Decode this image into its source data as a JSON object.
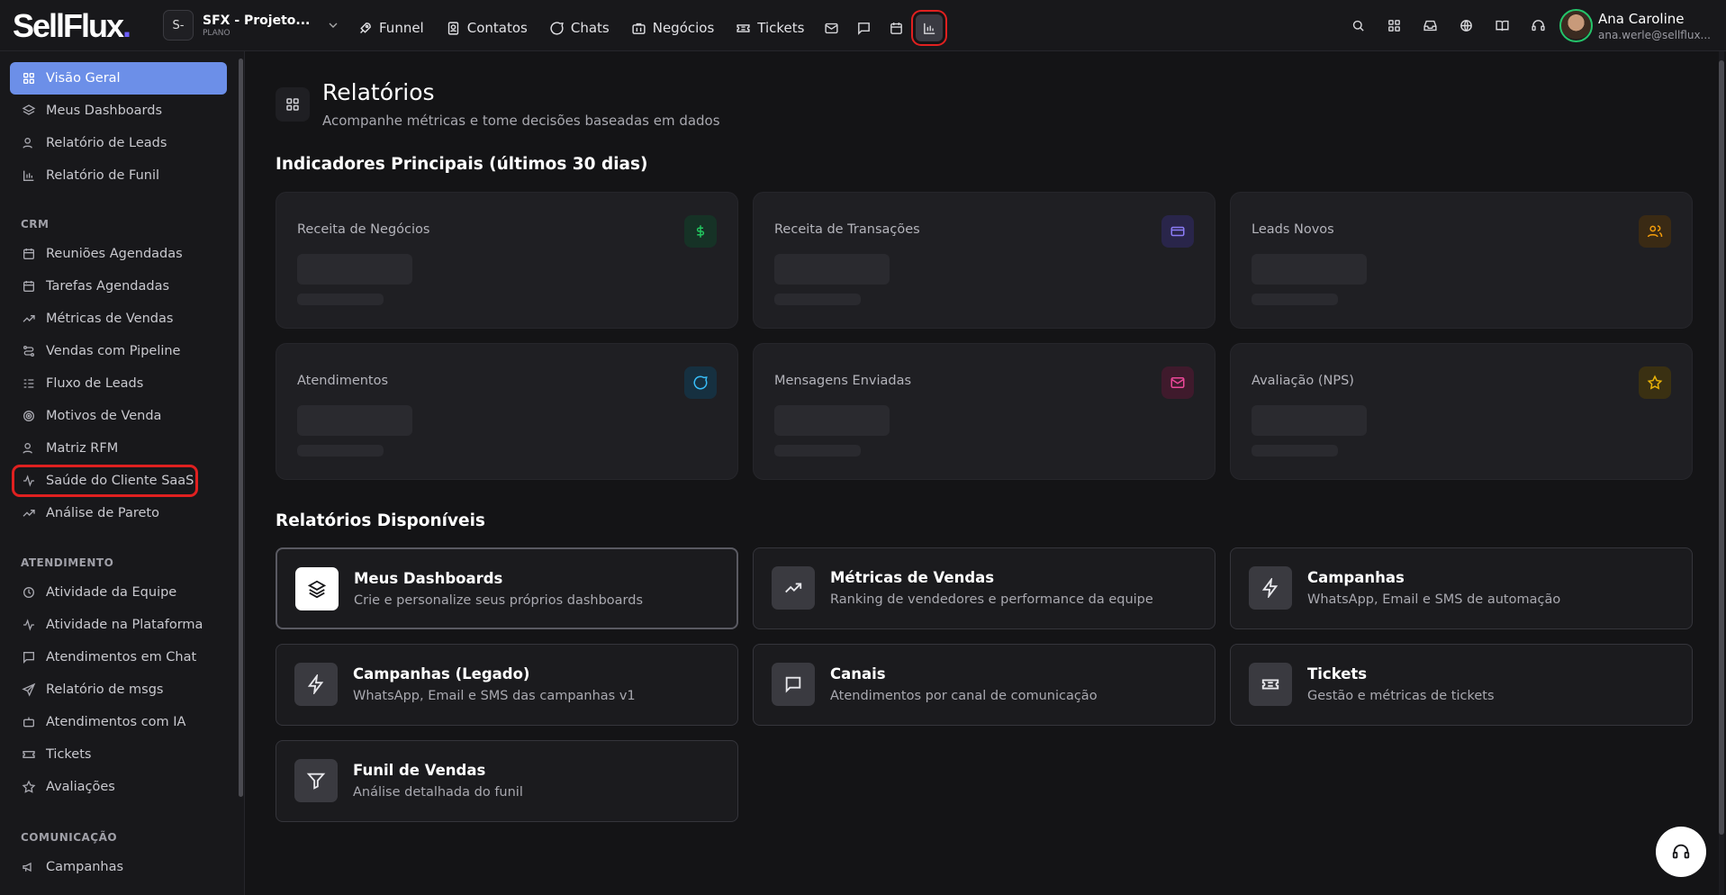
{
  "brand": {
    "logo_text": "SellFlux",
    "logo_dot": "."
  },
  "workspace": {
    "initial": "S-",
    "name": "SFX - Projeto...",
    "plan": "PLANO"
  },
  "topnav": {
    "items": [
      {
        "label": "Funnel",
        "icon": "rocket-icon"
      },
      {
        "label": "Contatos",
        "icon": "contacts-icon"
      },
      {
        "label": "Chats",
        "icon": "chat-icon"
      },
      {
        "label": "Negócios",
        "icon": "briefcase-icon"
      },
      {
        "label": "Tickets",
        "icon": "ticket-icon"
      }
    ],
    "icon_buttons": [
      "mail-icon",
      "message-square-icon",
      "calendar-icon",
      "bar-chart-icon"
    ],
    "right_icons": [
      "search-icon",
      "grid-icon",
      "inbox-icon",
      "globe-icon",
      "book-icon",
      "headset-icon"
    ]
  },
  "user": {
    "name": "Ana Caroline",
    "email": "ana.werle@sellflux..."
  },
  "sidebar": {
    "top_items": [
      {
        "label": "Visão Geral",
        "icon": "grid-icon",
        "active": true
      },
      {
        "label": "Meus Dashboards",
        "icon": "layers-icon"
      },
      {
        "label": "Relatório de Leads",
        "icon": "users-icon"
      },
      {
        "label": "Relatório de Funil",
        "icon": "bar-chart-icon"
      }
    ],
    "crm_title": "CRM",
    "crm_items": [
      {
        "label": "Reuniões Agendadas",
        "icon": "calendar-clock-icon"
      },
      {
        "label": "Tarefas Agendadas",
        "icon": "calendar-icon"
      },
      {
        "label": "Métricas de Vendas",
        "icon": "trending-up-icon"
      },
      {
        "label": "Vendas com Pipeline",
        "icon": "pipeline-icon"
      },
      {
        "label": "Fluxo de Leads",
        "icon": "list-icon"
      },
      {
        "label": "Motivos de Venda",
        "icon": "target-icon"
      },
      {
        "label": "Matriz RFM",
        "icon": "users-icon"
      },
      {
        "label": "Saúde do Cliente SaaS",
        "icon": "activity-icon"
      },
      {
        "label": "Análise de Pareto",
        "icon": "trending-up-icon"
      }
    ],
    "atendimento_title": "ATENDIMENTO",
    "atendimento_items": [
      {
        "label": "Atividade da Equipe",
        "icon": "clock-icon"
      },
      {
        "label": "Atividade na Plataforma",
        "icon": "activity-icon"
      },
      {
        "label": "Atendimentos em Chat",
        "icon": "message-square-icon"
      },
      {
        "label": "Relatório de msgs",
        "icon": "send-icon"
      },
      {
        "label": "Atendimentos com IA",
        "icon": "bot-icon"
      },
      {
        "label": "Tickets",
        "icon": "ticket-icon"
      },
      {
        "label": "Avaliações",
        "icon": "star-icon"
      }
    ],
    "comunicacao_title": "COMUNICAÇÃO",
    "comunicacao_items": [
      {
        "label": "Campanhas",
        "icon": "megaphone-icon"
      }
    ]
  },
  "page": {
    "title": "Relatórios",
    "subtitle": "Acompanhe métricas e tome decisões baseadas em dados",
    "kpi_section_title": "Indicadores Principais (últimos 30 dias)",
    "reports_section_title": "Relatórios Disponíveis"
  },
  "kpis": [
    {
      "label": "Receita de Negócios",
      "icon": "dollar-icon",
      "color": "#22c55e",
      "bg": "#163226"
    },
    {
      "label": "Receita de Transações",
      "icon": "credit-card-icon",
      "color": "#8b7cf6",
      "bg": "#29254a"
    },
    {
      "label": "Leads Novos",
      "icon": "users-icon",
      "color": "#f59e0b",
      "bg": "#3a2a14"
    },
    {
      "label": "Atendimentos",
      "icon": "chat-icon",
      "color": "#38bdf8",
      "bg": "#163040"
    },
    {
      "label": "Mensagens Enviadas",
      "icon": "mail-icon",
      "color": "#ec4899",
      "bg": "#3f1a2c"
    },
    {
      "label": "Avaliação (NPS)",
      "icon": "star-icon",
      "color": "#eab308",
      "bg": "#3a3012"
    }
  ],
  "reports": [
    {
      "title": "Meus Dashboards",
      "desc": "Crie e personalize seus próprios dashboards",
      "icon": "layers-icon"
    },
    {
      "title": "Métricas de Vendas",
      "desc": "Ranking de vendedores e performance da equipe",
      "icon": "trending-up-icon"
    },
    {
      "title": "Campanhas",
      "desc": "WhatsApp, Email e SMS de automação",
      "icon": "zap-icon"
    },
    {
      "title": "Campanhas (Legado)",
      "desc": "WhatsApp, Email e SMS das campanhas v1",
      "icon": "zap-icon"
    },
    {
      "title": "Canais",
      "desc": "Atendimentos por canal de comunicação",
      "icon": "message-square-icon"
    },
    {
      "title": "Tickets",
      "desc": "Gestão e métricas de tickets",
      "icon": "ticket-icon"
    },
    {
      "title": "Funil de Vendas",
      "desc": "Análise detalhada do funil",
      "icon": "filter-icon"
    }
  ],
  "fab": {
    "icon": "headset-icon"
  }
}
